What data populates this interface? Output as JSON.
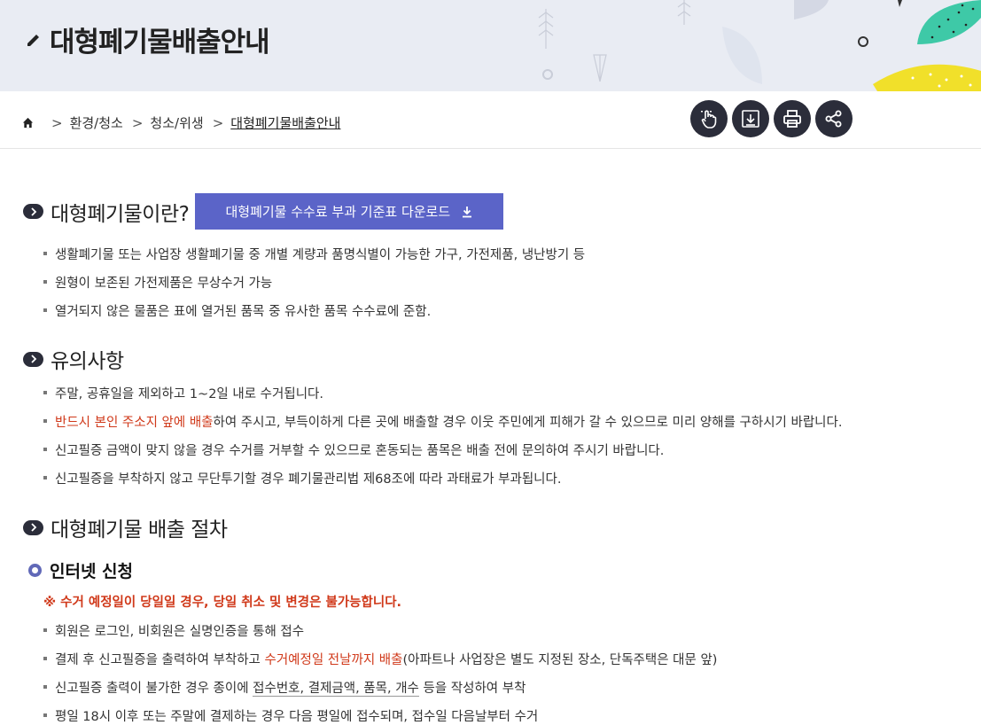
{
  "page": {
    "title": "대형폐기물배출안내"
  },
  "breadcrumb": {
    "items": [
      "환경/청소",
      "청소/위생",
      "대형폐기물배출안내"
    ],
    "separator": ">"
  },
  "tools": {
    "icons": [
      "touch-icon",
      "download-icon",
      "print-icon",
      "share-icon"
    ]
  },
  "sections": {
    "about": {
      "title": "대형폐기물이란?",
      "download_label": "대형폐기물 수수료 부과 기준표 다운로드",
      "items": [
        "생활폐기물 또는 사업장 생활폐기물 중 개별 계량과 품명식별이 가능한 가구, 가전제품, 냉난방기 등",
        "원형이 보존된 가전제품은 무상수거 가능",
        "열거되지 않은 물품은 표에 열거된 품목 중 유사한 품목 수수료에 준함."
      ]
    },
    "cautions": {
      "title": "유의사항",
      "item1": "주말, 공휴일을 제외하고 1~2일 내로 수거됩니다.",
      "item2_red": "반드시 본인 주소지 앞에 배출",
      "item2_rest": "하여 주시고, 부득이하게 다른 곳에 배출할 경우 이웃 주민에게 피해가 갈 수 있으므로 미리 양해를 구하시기 바랍니다.",
      "item3": "신고필증 금액이 맞지 않을 경우 수거를 거부할 수 있으므로 혼동되는 품목은 배출 전에 문의하여 주시기 바랍니다.",
      "item4": "신고필증을 부착하지 않고 무단투기할 경우 폐기물관리법 제68조에 따라 과태료가 부과됩니다."
    },
    "procedure": {
      "title": "대형폐기물 배출 절차",
      "online": {
        "title": "인터넷 신청",
        "notice": "※ 수거 예정일이 당일일 경우, 당일 취소 및 변경은 불가능합니다.",
        "item1": "회원은 로그인, 비회원은 실명인증을 통해 접수",
        "item2_a": "결제 후 신고필증을 출력하여 부착하고 ",
        "item2_red": "수거예정일 전날까지 배출",
        "item2_b": "(아파트나 사업장은 별도 지정된 장소, 단독주택은 대문 앞)",
        "item3_a": "신고필증 출력이 불가한 경우 종이에 ",
        "item3_u": "접수번호, 결제금액, 품목, 개수",
        "item3_b": " 등을 작성하여 부착",
        "item4": "평일 18시 이후 또는 주말에 결제하는 경우 다음 평일에 접수되며, 접수일 다음날부터 수거"
      }
    }
  },
  "colors": {
    "accent": "#5b64c8",
    "dark": "#2b2d3a",
    "red": "#d0391a",
    "banner": "#e9ecf3"
  }
}
